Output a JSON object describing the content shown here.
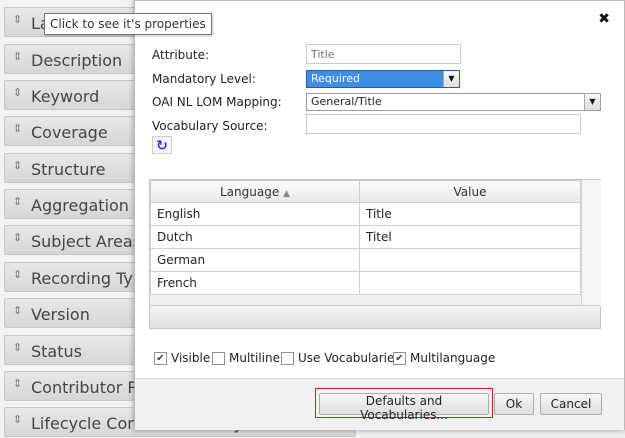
{
  "tooltip": "Click to see it's properties",
  "background_list": [
    {
      "label": "La"
    },
    {
      "label": "Description"
    },
    {
      "label": "Keyword"
    },
    {
      "label": "Coverage"
    },
    {
      "label": "Structure"
    },
    {
      "label": "Aggregation L"
    },
    {
      "label": "Subject Areas"
    },
    {
      "label": "Recording Typ"
    },
    {
      "label": "Version"
    },
    {
      "label": "Status"
    },
    {
      "label": "Contributor Ro"
    },
    {
      "label": "Lifecycle Contribute Entity"
    }
  ],
  "dialog": {
    "fields": {
      "attribute_label": "Attribute:",
      "attribute_placeholder": "Title",
      "mandatory_label": "Mandatory Level:",
      "mandatory_value": "Required",
      "mapping_label": "OAI NL LOM Mapping:",
      "mapping_value": "General/Title",
      "vocab_label": "Vocabulary Source:"
    },
    "grid": {
      "headers": {
        "language": "Language",
        "value": "Value"
      },
      "rows": [
        {
          "language": "English",
          "value": "Title"
        },
        {
          "language": "Dutch",
          "value": "Titel"
        },
        {
          "language": "German",
          "value": ""
        },
        {
          "language": "French",
          "value": ""
        }
      ]
    },
    "options": {
      "visible": "Visible",
      "multiline": "Multiline",
      "use_vocabularies": "Use Vocabularies",
      "multilanguage": "Multilanguage"
    },
    "buttons": {
      "defaults": "Defaults and Vocabularies...",
      "ok": "Ok",
      "cancel": "Cancel"
    }
  }
}
